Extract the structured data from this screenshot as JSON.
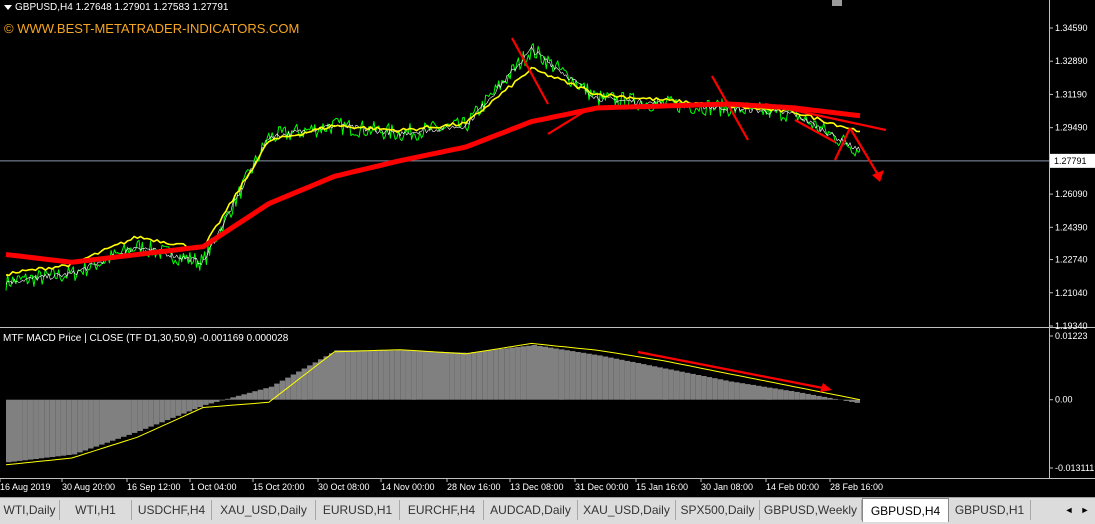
{
  "window": {
    "title": "GBPUSD,H4  1.27648 1.27901 1.27583 1.27791",
    "watermark": "© WWW.BEST-METATRADER-INDICATORS.COM"
  },
  "price_axis": {
    "labels": [
      "1.34590",
      "1.32890",
      "1.31190",
      "1.29490",
      "1.27791",
      "1.26090",
      "1.24390",
      "1.22740",
      "1.21040",
      "1.19340"
    ],
    "current_price": "1.27791"
  },
  "indicator": {
    "label": "MTF MACD Price | CLOSE  (TF D1,30,50,9) -0.001169 0.000028",
    "axis_labels": [
      "0.01223",
      "0.00",
      "-0.013111"
    ]
  },
  "time_axis": {
    "labels": [
      "16 Aug 2019",
      "30 Aug 20:00",
      "16 Sep 12:00",
      "1 Oct 04:00",
      "15 Oct 20:00",
      "30 Oct 08:00",
      "14 Nov 00:00",
      "28 Nov 16:00",
      "13 Dec 08:00",
      "31 Dec 00:00",
      "15 Jan 16:00",
      "30 Jan 08:00",
      "14 Feb 00:00",
      "28 Feb 16:00"
    ]
  },
  "tabs": [
    "WTI,Daily",
    "WTI,H1",
    "USDCHF,H4",
    "XAU_USD,Daily",
    "EURUSD,H1",
    "EURCHF,H4",
    "AUDCAD,Daily",
    "XAU_USD,Daily",
    "SPX500,Daily",
    "GBPUSD,Weekly",
    "GBPUSD,H4",
    "GBPUSD,H1"
  ],
  "active_tab": "GBPUSD,H4",
  "tab_nav": {
    "left": "◄",
    "right": "►"
  },
  "colors": {
    "background": "#000000",
    "price": "#00ff00",
    "fast_ma": "#ffff00",
    "slow_ma": "#ff0000",
    "annotation": "#ff0000",
    "histogram": "#808080",
    "signal": "#ffff00"
  },
  "chart_data": {
    "type": "line",
    "symbol": "GBPUSD",
    "timeframe": "H4",
    "ohlc": {
      "open": 1.27648,
      "high": 1.27901,
      "low": 1.27583,
      "close": 1.27791
    },
    "x": [
      "16 Aug 2019",
      "30 Aug 20:00",
      "16 Sep 12:00",
      "1 Oct 04:00",
      "15 Oct 20:00",
      "30 Oct 08:00",
      "14 Nov 00:00",
      "28 Nov 16:00",
      "13 Dec 08:00",
      "31 Dec 00:00",
      "15 Jan 16:00",
      "30 Jan 08:00",
      "14 Feb 00:00",
      "28 Feb 16:00"
    ],
    "series": [
      {
        "values": [
          1.216,
          1.22,
          1.234,
          1.226,
          1.29,
          1.296,
          1.292,
          1.296,
          1.335,
          1.31,
          1.307,
          1.305,
          1.302,
          1.283
        ]
      },
      {
        "values": [
          1.22,
          1.225,
          1.239,
          1.233,
          1.288,
          1.296,
          1.2935,
          1.297,
          1.325,
          1.312,
          1.309,
          1.306,
          1.303,
          1.293
        ]
      },
      {
        "values": [
          1.23,
          1.226,
          1.23,
          1.234,
          1.256,
          1.27,
          1.278,
          1.285,
          1.298,
          1.305,
          1.306,
          1.307,
          1.305,
          1.301
        ]
      }
    ],
    "ylim": [
      1.1934,
      1.3544
    ],
    "indicator": {
      "histogram": [
        -0.012,
        -0.0105,
        -0.006,
        -0.001,
        0.0025,
        0.0095,
        0.0095,
        0.009,
        0.0105,
        0.0085,
        0.006,
        0.0035,
        0.0015,
        -0.0008
      ],
      "signal": [
        -0.0125,
        -0.0112,
        -0.0072,
        -0.0015,
        -0.0005,
        0.0092,
        0.0096,
        0.0088,
        0.0108,
        0.0095,
        0.0075,
        0.005,
        0.0025,
        0.0
      ],
      "ylim": [
        -0.013111,
        0.01223
      ]
    }
  }
}
